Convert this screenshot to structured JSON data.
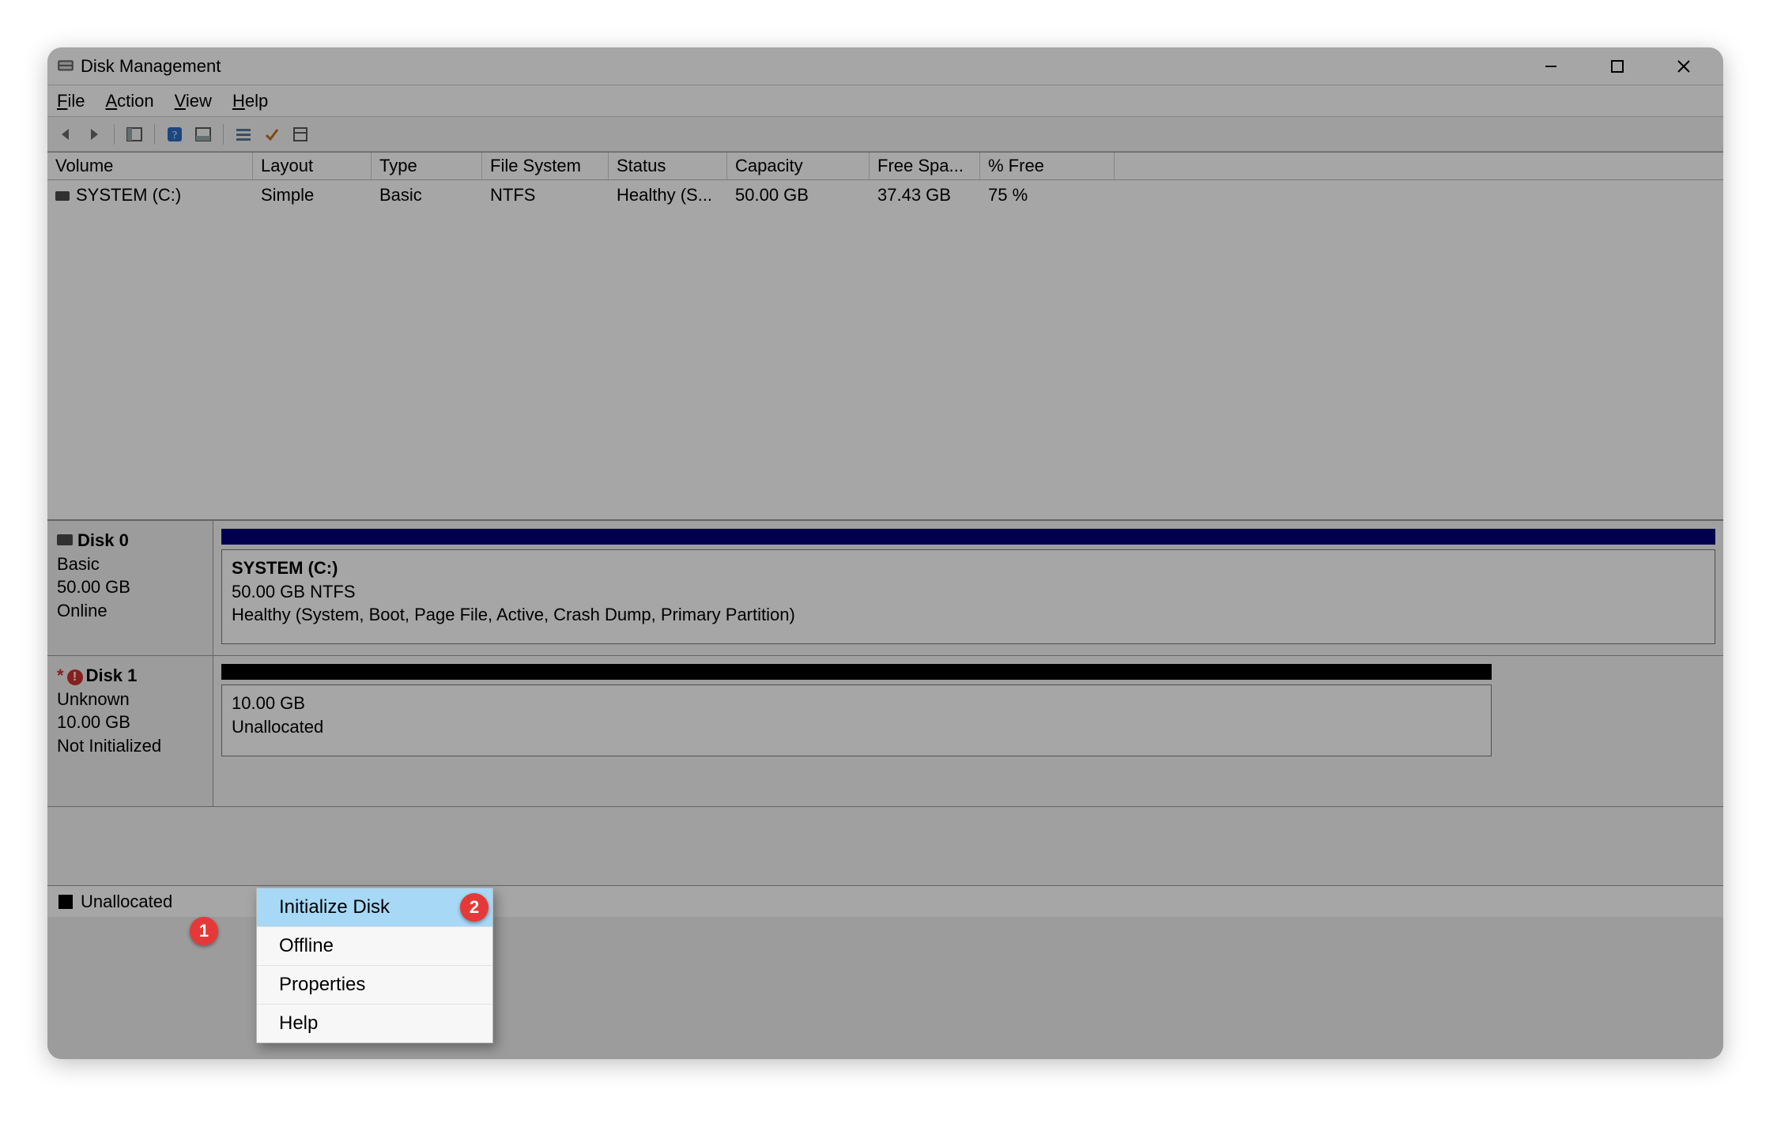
{
  "window": {
    "title": "Disk Management"
  },
  "menus": {
    "file": "File",
    "action": "Action",
    "view": "View",
    "help": "Help"
  },
  "columns": {
    "volume": "Volume",
    "layout": "Layout",
    "type": "Type",
    "fs": "File System",
    "status": "Status",
    "capacity": "Capacity",
    "free": "Free Spa...",
    "pct": "% Free"
  },
  "volumes": [
    {
      "name": "SYSTEM (C:)",
      "layout": "Simple",
      "type": "Basic",
      "fs": "NTFS",
      "status": "Healthy (S...",
      "capacity": "50.00 GB",
      "free": "37.43 GB",
      "pct": "75 %"
    }
  ],
  "disk0": {
    "name": "Disk 0",
    "type": "Basic",
    "size": "50.00 GB",
    "state": "Online",
    "partition": {
      "name": "SYSTEM  (C:)",
      "sizefs": "50.00 GB NTFS",
      "status": "Healthy (System, Boot, Page File, Active, Crash Dump, Primary Partition)"
    }
  },
  "disk1": {
    "name": "Disk 1",
    "type": "Unknown",
    "size": "10.00 GB",
    "state": "Not Initialized",
    "partition": {
      "size": "10.00 GB",
      "label_truncated": "Unallocated"
    }
  },
  "legend": {
    "unallocated": "Unallocated"
  },
  "context_menu": {
    "initialize": "Initialize Disk",
    "offline": "Offline",
    "properties": "Properties",
    "help": "Help"
  },
  "annotations": {
    "b1": "1",
    "b2": "2"
  }
}
